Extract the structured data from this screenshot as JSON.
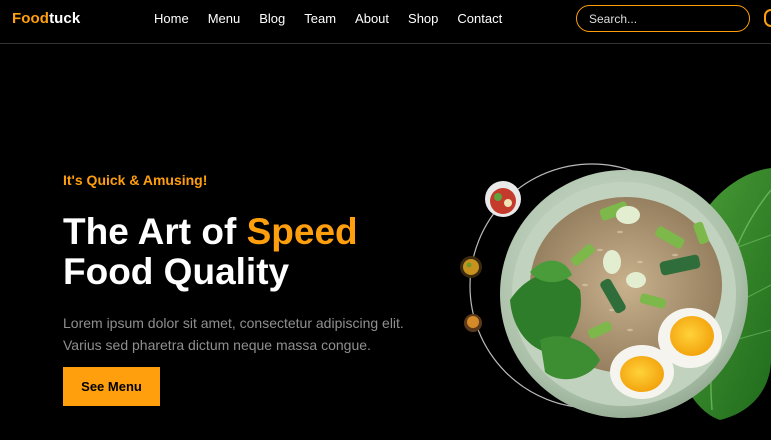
{
  "brand": {
    "accent": "Food",
    "rest": "tuck",
    "accent_color": "#FF9F0D"
  },
  "nav": {
    "items": [
      {
        "label": "Home"
      },
      {
        "label": "Menu"
      },
      {
        "label": "Blog"
      },
      {
        "label": "Team"
      },
      {
        "label": "About"
      },
      {
        "label": "Shop"
      },
      {
        "label": "Contact"
      }
    ]
  },
  "search": {
    "placeholder": "Search...",
    "value": ""
  },
  "hero": {
    "tagline": "It's Quick & Amusing!",
    "headline_part1": "The Art of ",
    "headline_highlight": "Speed",
    "headline_part2": "Food Quality",
    "description_line1": "Lorem ipsum dolor sit amet, consectetur adipiscing elit.",
    "description_line2": "Varius sed pharetra dictum neque massa congue.",
    "cta_label": "See Menu"
  },
  "graphics": {
    "main_dish_icon": "rice-salad-with-eggs-plate",
    "thumb_1_icon": "salad-bowl-thumbnail",
    "thumb_2_icon": "curry-bowl-thumbnail",
    "thumb_3_icon": "spice-bowl-thumbnail",
    "leaf_icon": "green-leaf",
    "colors": {
      "background": "#000000",
      "accent": "#FF9F0D",
      "text_muted": "#8f8f8f"
    }
  }
}
